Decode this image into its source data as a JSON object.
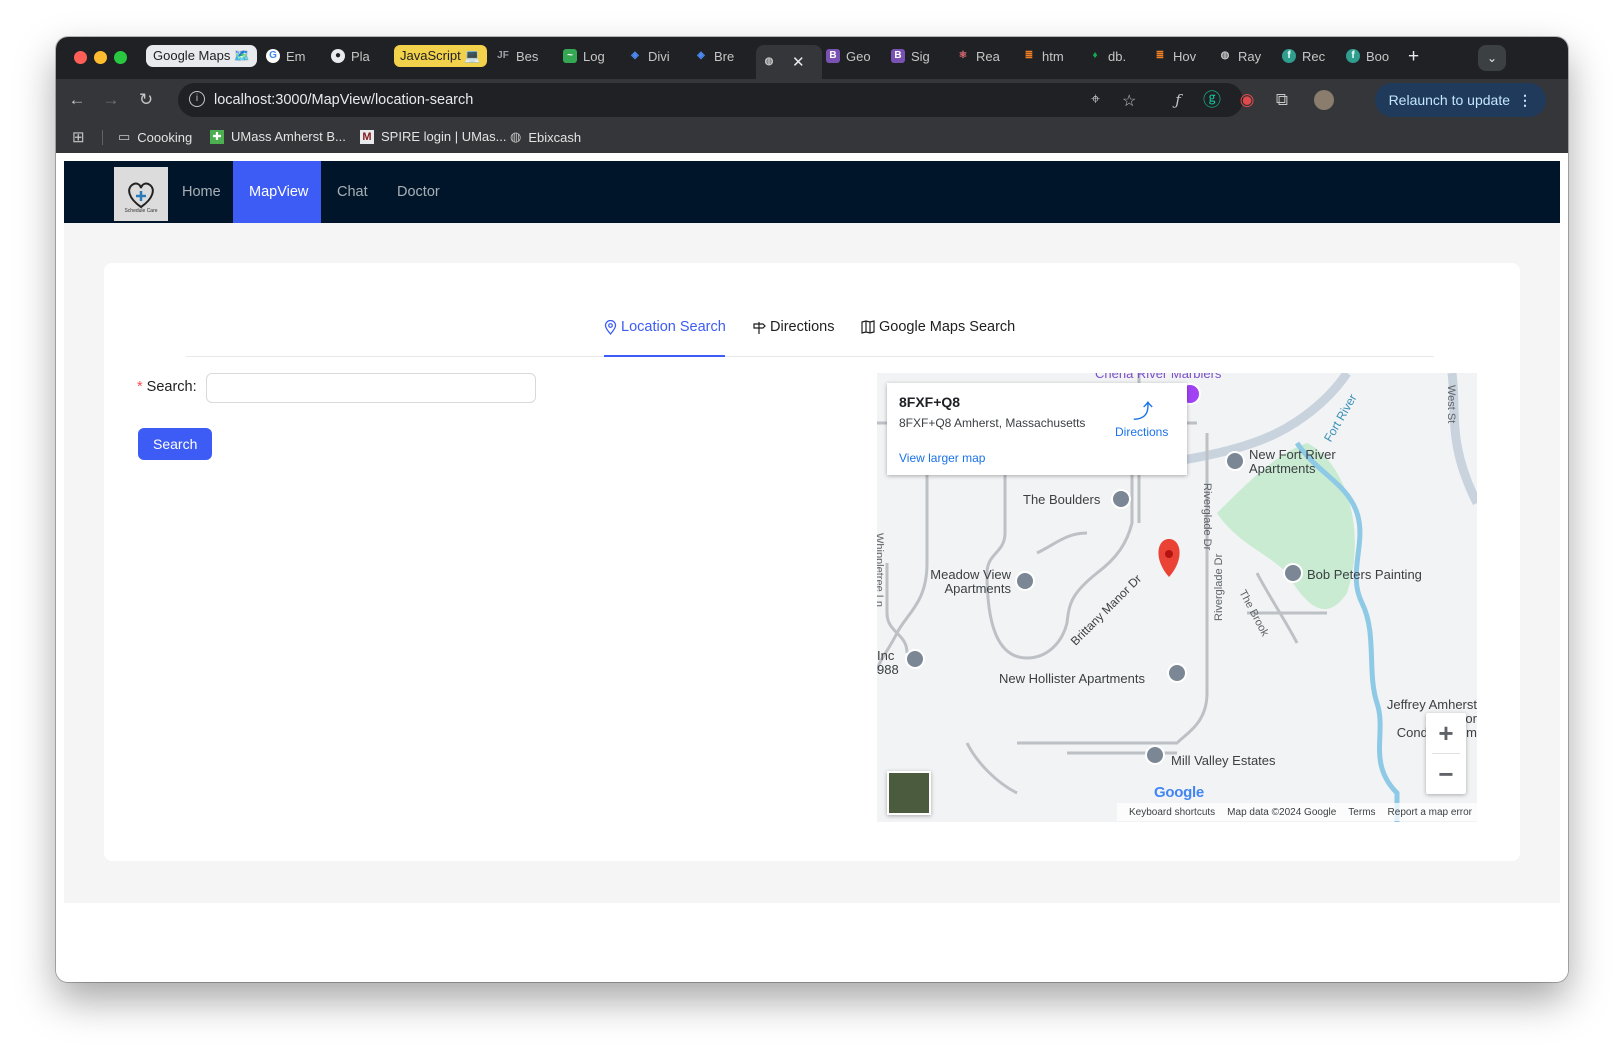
{
  "browser": {
    "tabs": [
      {
        "label": "Google Maps 🗺️",
        "icon": "google-maps-favicon"
      },
      {
        "label": "Em",
        "icon": "google-favicon"
      },
      {
        "label": "Pla",
        "icon": "github-favicon"
      },
      {
        "label": "JavaScript 💻",
        "icon": "javascript-badge"
      },
      {
        "label": "Bes",
        "icon": "jf-favicon"
      },
      {
        "label": "Log",
        "icon": "logo-favicon"
      },
      {
        "label": "Divi",
        "icon": "diamond-favicon"
      },
      {
        "label": "Bre",
        "icon": "diamond-favicon"
      },
      {
        "label": "",
        "icon": "globe-favicon"
      },
      {
        "label": "Geo",
        "icon": "bootstrap-favicon"
      },
      {
        "label": "Sig",
        "icon": "bootstrap-favicon"
      },
      {
        "label": "Rea",
        "icon": "react-favicon"
      },
      {
        "label": "htm",
        "icon": "stackoverflow-favicon"
      },
      {
        "label": "db.",
        "icon": "mongodb-favicon"
      },
      {
        "label": "Hov",
        "icon": "stackoverflow-favicon"
      },
      {
        "label": "Ray",
        "icon": "globe-favicon"
      },
      {
        "label": "Rec",
        "icon": "f-favicon"
      },
      {
        "label": "Boo",
        "icon": "f-favicon"
      }
    ],
    "url": "localhost:3000/MapView/location-search",
    "relaunch_label": "Relaunch to update",
    "bookmarks": [
      {
        "label": "Coooking",
        "icon": "folder-icon"
      },
      {
        "label": "UMass Amherst B...",
        "icon": "umass-favicon"
      },
      {
        "label": "SPIRE login | UMas...",
        "icon": "umass-m-favicon"
      },
      {
        "label": "Ebixcash",
        "icon": "globe-favicon"
      }
    ]
  },
  "app": {
    "nav": {
      "logo_text": "Schedule Care",
      "items": [
        "Home",
        "MapView",
        "Chat",
        "Doctor"
      ],
      "selected": "MapView"
    },
    "tabs": [
      "Location Search",
      "Directions",
      "Google Maps Search"
    ],
    "active_tab": "Location Search",
    "form": {
      "label": "Search",
      "required_mark": "*",
      "value": "",
      "button": "Search"
    },
    "map": {
      "info": {
        "title": "8FXF+Q8",
        "address": "8FXF+Q8 Amherst, Massachusetts",
        "directions": "Directions",
        "view_larger": "View larger map"
      },
      "places": [
        "New Fort River Apartments",
        "The Boulders",
        "Meadow View Apartments",
        "Bob Peters Painting",
        "New Hollister Apartments",
        "Mill Valley Estates",
        "Jeffrey Amherst Manor Condominium",
        "Inc 988",
        "Chena River Marblers"
      ],
      "roads": [
        "Brittany Manor Dr",
        "Riverglade Dr",
        "Whippletree Ln",
        "The Brook",
        "West St",
        "Fort River"
      ],
      "zoom_in": "+",
      "zoom_out": "−",
      "attribution": [
        "Keyboard shortcuts",
        "Map data ©2024 Google",
        "Terms",
        "Report a map error"
      ],
      "brand": "Google"
    }
  }
}
